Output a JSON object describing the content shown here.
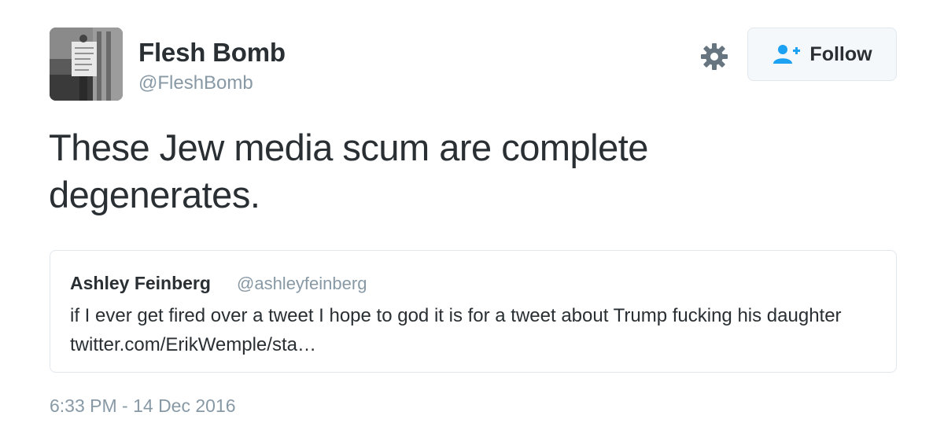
{
  "author": {
    "name": "Flesh Bomb",
    "handle": "@FleshBomb",
    "avatar_icon": "profile-photo-protester-sign"
  },
  "actions": {
    "settings_icon": "gear-icon",
    "follow_icon": "add-user-icon",
    "follow_label": "Follow"
  },
  "tweet": {
    "text": "These Jew media scum are complete degenerates.",
    "timestamp": "6:33 PM - 14 Dec 2016"
  },
  "quoted_tweet": {
    "name": "Ashley Feinberg",
    "handle": "@ashleyfeinberg",
    "text": "if I ever get fired over a tweet I hope to god it is for a tweet about Trump fucking his daughter twitter.com/ErikWemple/sta…"
  },
  "colors": {
    "text": "#292f33",
    "muted": "#8899a6",
    "accent": "#1da1f2",
    "border": "#e1e8ed",
    "button_bg": "#f5f8fa"
  }
}
